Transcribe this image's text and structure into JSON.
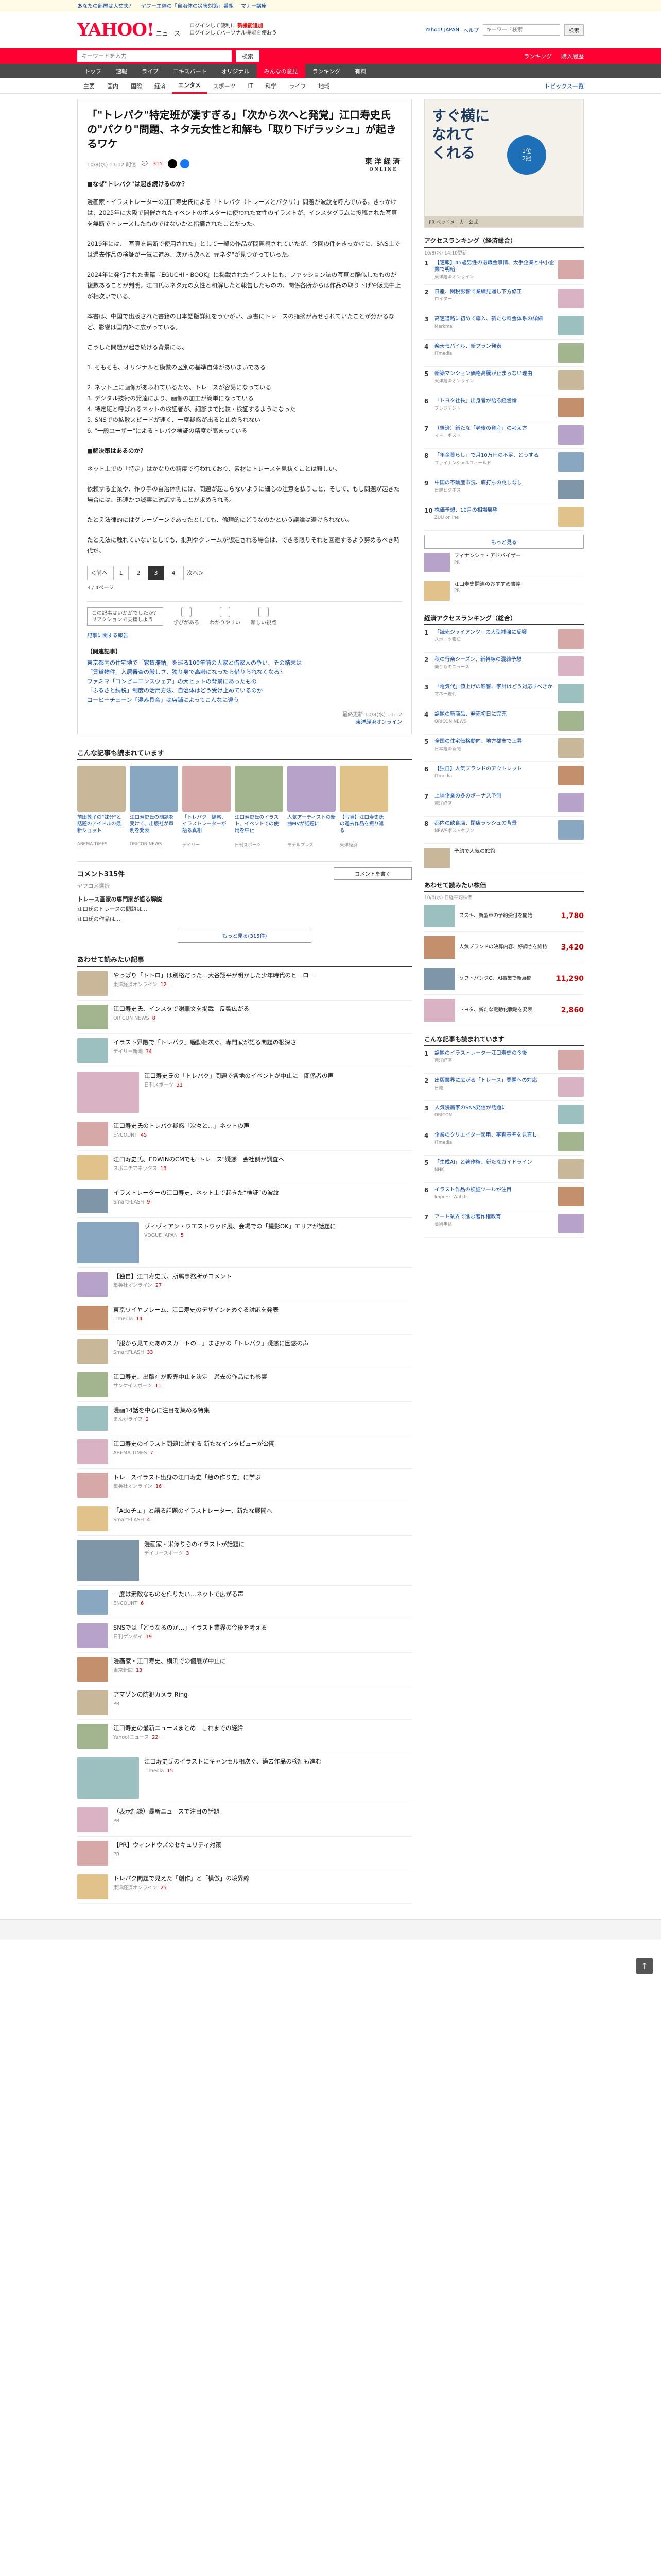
{
  "topbar": {
    "links": [
      "あなたの部屋は大丈夫？",
      "ヤフー主催の「自治体の災害対策」番組",
      "マナー講座",
      "Yahoo! JAPAN"
    ],
    "right": [
      "ヘルプ"
    ]
  },
  "header": {
    "logo": "YAHOO!",
    "logo_sub": "ニュース",
    "mid_line1": "ログインして便利に",
    "mid_red": "新機能追加",
    "mid_line2": "ログインしてパーソナル機能を使おう",
    "links": [
      "Yahoo! JAPAN",
      "ヘルプ"
    ],
    "search_placeholder": "キーワード検索",
    "search_button": "検索",
    "login": "ログイン"
  },
  "searchband": {
    "placeholder": "キーワードを入力",
    "button": "検索",
    "right": [
      "ランキング",
      "購入履歴"
    ]
  },
  "nav": [
    "トップ",
    "速報",
    "ライブ",
    "エキスパート",
    "オリジナル",
    "みんなの意見",
    "ランキング",
    "有料"
  ],
  "nav_active": 5,
  "subnav": [
    "主要",
    "国内",
    "国際",
    "経済",
    "エンタメ",
    "スポーツ",
    "IT",
    "科学",
    "ライフ",
    "地域"
  ],
  "subnav_active": 4,
  "subnav_right": "トピックス一覧",
  "article": {
    "title": "「\"トレパク\"特定班が凄すぎる」「次から次へと発覚」江口寿史氏の\"パクり\"問題、ネタ元女性と和解も「取り下げラッシュ」が起きるワケ",
    "date": "10/8(水) 11:12 配信",
    "comments": "315",
    "brand": "東洋経済",
    "brand_sub": "ONLINE",
    "body": [
      {
        "h": "■なぜ\"トレパク\"は起き続けるのか？"
      },
      {
        "p": "漫画家・イラストレーターの江口寿史氏による「トレパク（トレースとパクリ）」問題が波紋を呼んでいる。きっかけは、2025年に大阪で開催されたイベントのポスターに使われた女性のイラストが、インスタグラムに投稿された写真を無断でトレースしたものではないかと指摘されたことだった。"
      },
      {
        "p": "2019年には、「写真を無断で使用された」として一部の作品が問題視されていたが、今回の件をきっかけに、SNS上では過去作品の検証が一気に進み、次から次へと\"元ネタ\"が見つかっていった。"
      },
      {
        "p": "2024年に発行された書籍『EGUCHI・BOOK』に掲載されたイラストにも、ファッション誌の写真と酷似したものが複数あることが判明。江口氏はネタ元の女性と和解したと報告したものの、関係各所からは作品の取り下げや販売中止が相次いでいる。"
      },
      {
        "p": "本書は、中国で出版された書籍の日本語版詳細をうかがい、原書にトレースの指摘が寄せられていたことが分かるなど、影響は国内外に広がっている。"
      },
      {
        "p": "こうした問題が起き続ける背景には、"
      },
      {
        "p": "1. そもそも、オリジナルと模倣の区別の基準自体があいまいである"
      },
      {
        "p": "2. ネット上に画像があふれているため、トレースが容易になっている\n3. デジタル技術の発達により、画像の加工が簡単になっている\n4. 特定班と呼ばれるネットの検証者が、細部まで比較・検証するようになった\n5. SNSでの拡散スピードが速く、一度疑惑が出ると止められない\n6. \"一般ユーザー\"によるトレパク検証の精度が高まっている"
      },
      {
        "h": "■解決策はあるのか？"
      },
      {
        "p": "ネット上での「特定」はかなりの精度で行われており、素材にトレースを見抜くことは難しい。"
      },
      {
        "p": "依頼する企業や、作り手の自治体側には、問題が起こらないように細心の注意を払うこと、そして、もし問題が起きた場合には、迅速かつ誠実に対応することが求められる。"
      },
      {
        "p": "たとえ法律的にはグレーゾーンであったとしても、倫理的にどうなのかという議論は避けられない。"
      },
      {
        "p": "たとえ法に触れていないとしても、批判やクレームが想定される場合は、できる限りそれを回避するよう努めるべき時代だ。"
      }
    ],
    "pages": [
      "＜前へ",
      "1",
      "2",
      "3",
      "4",
      "次へ＞"
    ],
    "current_page": 3,
    "pageinfo": "3 / 4ページ",
    "react_tip": "この記事はいかがでしたか？\nリアクションで支援しよう",
    "reactions": [
      "学びがある",
      "わかりやすい",
      "新しい視点"
    ],
    "small_links": [
      "記事に関する報告"
    ],
    "related_title": "【関連記事】",
    "related": [
      "東京都内の住宅地で「家賃滞納」を巡る100年前の大家と借家人の争い、その結末は",
      "「賃貸物件」入居審査の厳しさ、独り身で高齢になったら借りられなくなる？",
      "ファミマ「コンビニエンスウェア」の大ヒットの背景にあったもの",
      "「ふるさと納税」制度の活用方法、自治体はどう受け止めているのか",
      "コーヒーチェーン「混み具合」は店舗によってこんなに違う"
    ],
    "copyline": "最終更新:10/8(水) 11:12",
    "copysrc": "東洋経済オンライン"
  },
  "photos": {
    "title": "こんな記事も読まれています",
    "items": [
      {
        "cap": "前田敦子の“妹分”と話題のアイドルの最新ショット",
        "src": "ABEMA TIMES"
      },
      {
        "cap": "江口寿史氏の問題を受けて、出版社が声明を発表",
        "src": "ORICON NEWS"
      },
      {
        "cap": "「トレパク」疑惑、イラストレーターが語る真相",
        "src": "デイリー"
      },
      {
        "cap": "江口寿史氏のイラスト、イベントでの使用を中止",
        "src": "日刊スポーツ"
      },
      {
        "cap": "人気アーティストの新曲MVが話題に",
        "src": "モデルプレス"
      },
      {
        "cap": "【写真】江口寿史氏の過去作品を振り返る",
        "src": "東洋経済"
      }
    ]
  },
  "comments": {
    "count": "コメント315件",
    "write": "コメントを書く",
    "section": "ヤフコメ選択",
    "expert_title": "トレース画家の専門家が語る解説",
    "lines": [
      "江口氏のトレースの問題は…",
      "江口氏の作品は…"
    ],
    "more": "もっと見る(315件)"
  },
  "list": {
    "title": "あわせて読みたい記事",
    "items": [
      {
        "t": "やっぱり「トトロ」は別格だった…大谷翔平が明かした少年時代のヒーロー",
        "s": "東洋経済オンライン",
        "c": "12"
      },
      {
        "t": "江口寿史氏、インスタで謝罪文を掲載　反響広がる",
        "s": "ORICON NEWS",
        "c": "8"
      },
      {
        "t": "イラスト界隈で「トレパク」騒動相次ぐ、専門家が語る問題の根深さ",
        "s": "デイリー新潮",
        "c": "34"
      },
      {
        "t": "江口寿史氏の「トレパク」問題で各地のイベントが中止に　関係者の声",
        "s": "日刊スポーツ",
        "c": "21"
      },
      {
        "t": "江口寿史氏のトレパク疑惑「次々と…」ネットの声",
        "s": "ENCOUNT",
        "c": "45"
      },
      {
        "t": "江口寿史氏、EDWINのCMでも\"トレース\"疑惑　会社側が調査へ",
        "s": "スポニチアネックス",
        "c": "18"
      },
      {
        "t": "イラストレーターの江口寿史、ネット上で起きた“検証”の波紋",
        "s": "SmartFLASH",
        "c": "9"
      },
      {
        "t": "ヴィヴィアン・ウエストウッド展、会場での「撮影OK」エリアが話題に",
        "s": "VOGUE JAPAN",
        "c": "5"
      },
      {
        "t": "【独自】江口寿史氏、所属事務所がコメント",
        "s": "集英社オンライン",
        "c": "27"
      },
      {
        "t": "東京ワイヤフレーム、江口寿史のデザインをめぐる対応を発表",
        "s": "ITmedia",
        "c": "14"
      },
      {
        "t": "「服から見てたあのスカートの…」まさかの「トレパク」疑惑に困惑の声",
        "s": "SmartFLASH",
        "c": "33"
      },
      {
        "t": "江口寿史、出版社が販売中止を決定　過去の作品にも影響",
        "s": "サンケイスポーツ",
        "c": "11"
      },
      {
        "t": "漫画14話を中心に注目を集める特集",
        "s": "まんがライフ",
        "c": "2"
      },
      {
        "t": "江口寿史のイラスト問題に対する 新たなインタビューが公開",
        "s": "ABEMA TIMES",
        "c": "7"
      },
      {
        "t": "トレースイラスト出身の江口寿史「絵の作り方」に学ぶ",
        "s": "集英社オンライン",
        "c": "16"
      },
      {
        "t": "「Adoチェ」と語る話題のイラストレーター、新たな展開へ",
        "s": "SmartFLASH",
        "c": "4"
      },
      {
        "t": "漫画家・米澤りらのイラストが話題に",
        "s": "デイリースポーツ",
        "c": "3"
      },
      {
        "t": "一度は素敵なものを作りたい…ネットで広がる声",
        "s": "ENCOUNT",
        "c": "6"
      },
      {
        "t": "SNSでは「どうなるのか…」イラスト業界の今後を考える",
        "s": "日刊ゲンダイ",
        "c": "19"
      },
      {
        "t": "漫画家・江口寿史、横浜での個展が中止に",
        "s": "東京新聞",
        "c": "13"
      },
      {
        "t": "アマゾンの防犯カメラ Ring",
        "s": "PR",
        "c": ""
      },
      {
        "t": "江口寿史の最新ニュースまとめ　これまでの経緯",
        "s": "Yahoo!ニュース",
        "c": "22"
      },
      {
        "t": "江口寿史氏のイラストにキャンセル相次ぐ、過去作品の検証も進む",
        "s": "ITmedia",
        "c": "15"
      },
      {
        "t": "（表示記録）最新ニュースで注目の話題",
        "s": "PR",
        "c": ""
      },
      {
        "t": "【PR】ウィンドウズのセキュリティ対策",
        "s": "PR",
        "c": ""
      },
      {
        "t": "トレパク問題で見えた「創作」と「模倣」の境界線",
        "s": "東洋経済オンライン",
        "c": "25"
      }
    ]
  },
  "side": {
    "ad_big": "すぐ横に\nなれて\nくれる",
    "ad_badge": "1位\n2冠",
    "ad_foot": "PR ベッドメーカー公式",
    "access_title": "アクセスランキング（経済総合）",
    "access_sub": "10/8(水) 14:10更新",
    "access": [
      {
        "t": "【速報】45歳男性の退職金事情、大手企業と中小企業で明暗",
        "s": "東洋経済オンライン"
      },
      {
        "t": "日産、関税影響で業績見通し下方修正",
        "s": "ロイター"
      },
      {
        "t": "高速道路に初めて導入、新たな料金体系の詳細",
        "s": "Merkmal"
      },
      {
        "t": "楽天モバイル、新プラン発表",
        "s": "ITmedia"
      },
      {
        "t": "新築マンション価格高騰が止まらない理由",
        "s": "東洋経済オンライン"
      },
      {
        "t": "「トヨタ社長」出身者が語る経営論",
        "s": "プレジデント"
      },
      {
        "t": "（経済）新たな「老後の資産」の考え方",
        "s": "マネーポスト"
      },
      {
        "t": "「年金暮らし」で月10万円の不足、どうする",
        "s": "ファイナンシャルフィールド"
      },
      {
        "t": "中国の不動産市況、底打ちの兆しなし",
        "s": "日経ビジネス"
      },
      {
        "t": "株価予想、10月の相場展望",
        "s": "ZUU online"
      }
    ],
    "access_more": "もっと見る",
    "pr_rows": [
      {
        "t": "フィナンシェ・アドバイザー",
        "pr": "PR"
      },
      {
        "t": "江口寿史関連のおすすめ書籍",
        "pr": "PR"
      }
    ],
    "eco_title": "経済アクセスランキング（総合）",
    "eco": [
      {
        "t": "「読売ジャイアンツ」の大型補強に反響",
        "s": "スポーツ報知"
      },
      {
        "t": "秋の行楽シーズン、新幹線の混雑予想",
        "s": "乗りものニュース"
      },
      {
        "t": "「電気代」値上げの影響、家計はどう対応すべきか",
        "s": "マネー現代"
      },
      {
        "t": "話題の新商品、発売初日に完売",
        "s": "ORICON NEWS"
      },
      {
        "t": "全国の住宅価格動向、地方都市で上昇",
        "s": "日本経済新聞"
      },
      {
        "t": "【独自】人気ブランドのアウトレット",
        "s": "ITmedia"
      },
      {
        "t": "上場企業の冬のボーナス予測",
        "s": "東洋経済"
      },
      {
        "t": "都内の飲食店、閉店ラッシュの背景",
        "s": "NEWSポストセブン"
      }
    ],
    "eco_pr": "予約で人気の旅館",
    "stock_title": "あわせて読みたい株価",
    "stock_sub": "10/8(水) 日経平均株価",
    "stocks": [
      {
        "t": "スズキ、新型車の予約受付を開始",
        "p": "1,780"
      },
      {
        "t": "人気ブランドの決算内容、好調さを維持",
        "p": "3,420"
      },
      {
        "t": "ソフトバンクG、AI事業で新展開",
        "p": "11,290"
      },
      {
        "t": "トヨタ、新たな電動化戦略を発表",
        "p": "2,860"
      }
    ],
    "news_title": "こんな記事も読まれています",
    "news": [
      {
        "t": "話題のイラストレーター江口寿史の今後",
        "s": "東洋経済"
      },
      {
        "t": "出版業界に広がる「トレース」問題への対応",
        "s": "日経"
      },
      {
        "t": "人気漫画家のSNS発信が話題に",
        "s": "ORICON"
      },
      {
        "t": "企業のクリエイター起用、審査基準を見直し",
        "s": "ITmedia"
      },
      {
        "t": "「生成AI」と著作権、新たなガイドライン",
        "s": "NHK"
      },
      {
        "t": "イラスト作品の検証ツールが注目",
        "s": "Impress Watch"
      },
      {
        "t": "アート業界で進む著作権教育",
        "s": "美術手帖"
      }
    ],
    "to_top": "↑"
  }
}
